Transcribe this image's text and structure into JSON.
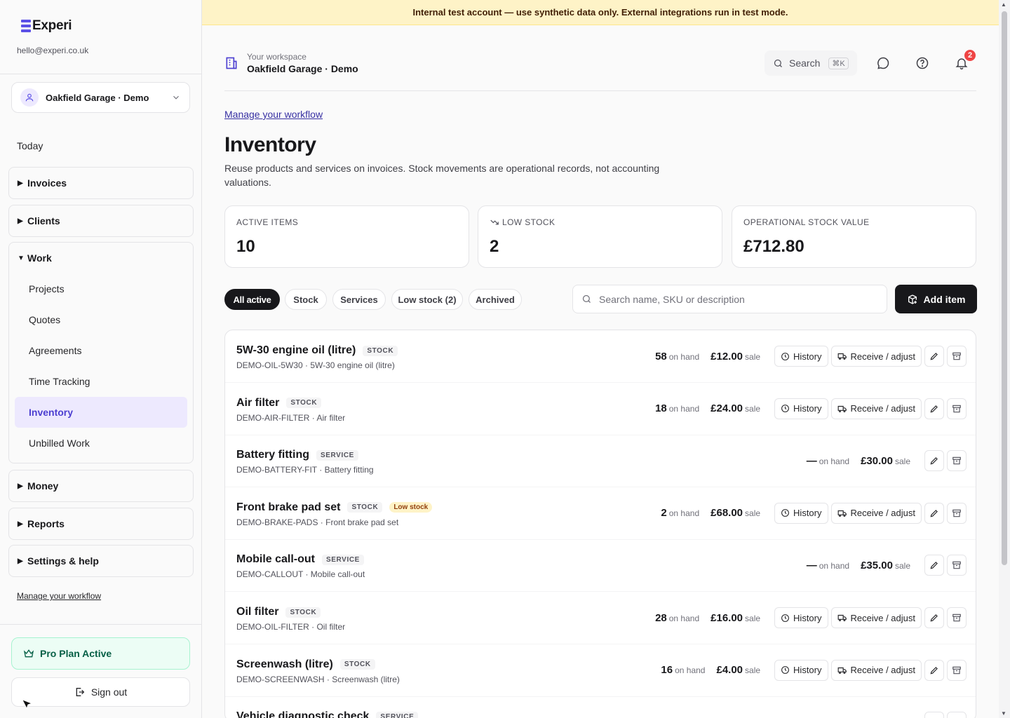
{
  "banner": {
    "text": "Internal test account — use synthetic data only. External integrations run in test mode."
  },
  "sidebar": {
    "brand": "Experi",
    "email": "hello@experi.co.uk",
    "workspace_select": "Oakfield Garage · Demo",
    "today": "Today",
    "groups": {
      "invoices": "Invoices",
      "clients": "Clients",
      "work": "Work",
      "money": "Money",
      "reports": "Reports",
      "settings": "Settings & help"
    },
    "work_items": [
      "Projects",
      "Quotes",
      "Agreements",
      "Time Tracking",
      "Inventory",
      "Unbilled Work"
    ],
    "manage_link": "Manage your workflow",
    "plan": "Pro Plan Active",
    "sign_out": "Sign out"
  },
  "header": {
    "workspace_label": "Your workspace",
    "workspace_name": "Oakfield Garage · Demo",
    "search_label": "Search",
    "search_shortcut": "⌘K",
    "notification_count": "2"
  },
  "main": {
    "manage_link": "Manage your workflow",
    "title": "Inventory",
    "description": "Reuse products and services on invoices. Stock movements are operational records, not accounting valuations.",
    "stats": [
      {
        "label": "ACTIVE ITEMS",
        "value": "10"
      },
      {
        "label": "LOW STOCK",
        "value": "2"
      },
      {
        "label": "OPERATIONAL STOCK VALUE",
        "value": "£712.80"
      }
    ],
    "filters": [
      "All active",
      "Stock",
      "Services",
      "Low stock (2)",
      "Archived"
    ],
    "search_placeholder": "Search name, SKU or description",
    "add_item": "Add item"
  },
  "labels": {
    "on_hand": "on hand",
    "sale": "sale",
    "history": "History",
    "receive": "Receive / adjust"
  },
  "items": [
    {
      "name": "5W-30 engine oil (litre)",
      "type": "STOCK",
      "sub": "DEMO-OIL-5W30 · 5W-30 engine oil (litre)",
      "on_hand": "58",
      "price": "£12.00"
    },
    {
      "name": "Air filter",
      "type": "STOCK",
      "sub": "DEMO-AIR-FILTER · Air filter",
      "on_hand": "18",
      "price": "£24.00"
    },
    {
      "name": "Battery fitting",
      "type": "SERVICE",
      "sub": "DEMO-BATTERY-FIT · Battery fitting",
      "on_hand": "—",
      "price": "£30.00"
    },
    {
      "name": "Front brake pad set",
      "type": "STOCK",
      "badge": "Low stock",
      "sub": "DEMO-BRAKE-PADS · Front brake pad set",
      "on_hand": "2",
      "price": "£68.00"
    },
    {
      "name": "Mobile call-out",
      "type": "SERVICE",
      "sub": "DEMO-CALLOUT · Mobile call-out",
      "on_hand": "—",
      "price": "£35.00"
    },
    {
      "name": "Oil filter",
      "type": "STOCK",
      "sub": "DEMO-OIL-FILTER · Oil filter",
      "on_hand": "28",
      "price": "£16.00"
    },
    {
      "name": "Screenwash (litre)",
      "type": "STOCK",
      "sub": "DEMO-SCREENWASH · Screenwash (litre)",
      "on_hand": "16",
      "price": "£4.00"
    },
    {
      "name": "Vehicle diagnostic check",
      "type": "SERVICE",
      "sub": "",
      "on_hand": "",
      "price": ""
    }
  ]
}
